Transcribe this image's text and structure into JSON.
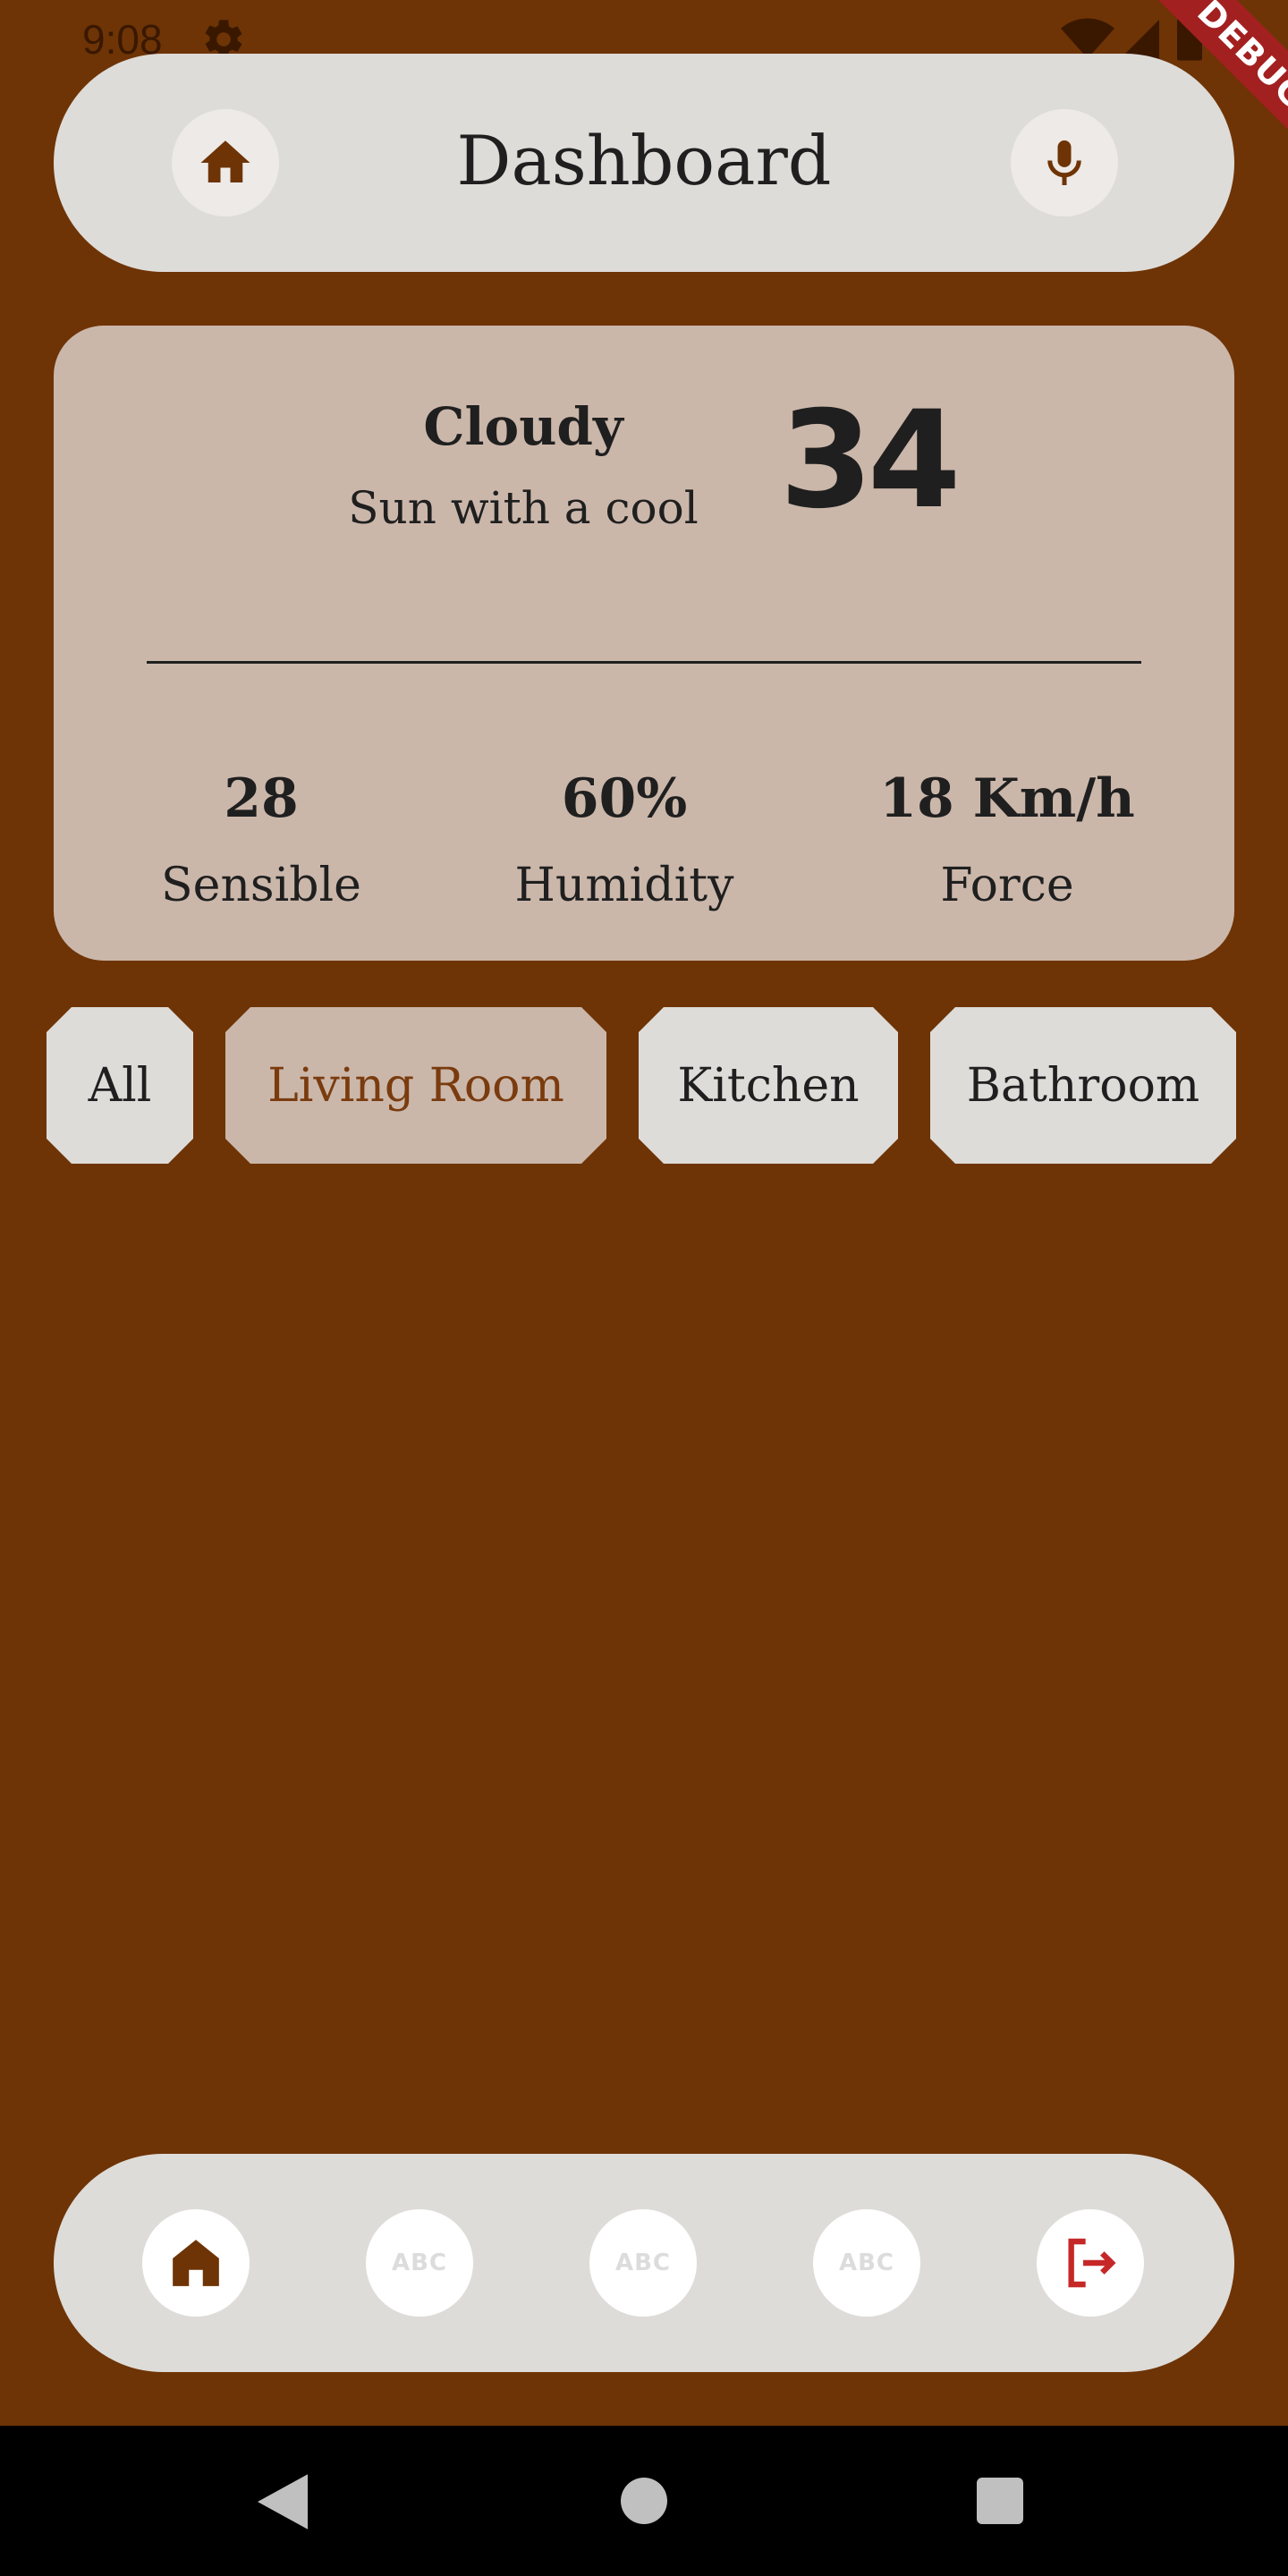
{
  "status_bar": {
    "time": "9:08",
    "icons": [
      "gear-icon",
      "wifi-icon",
      "signal-icon",
      "battery-icon"
    ]
  },
  "debug_banner": "DEBUG",
  "header": {
    "title": "Dashboard",
    "left_icon": "home-icon",
    "right_icon": "microphone-icon"
  },
  "weather": {
    "condition": "Cloudy",
    "description": "Sun with a cool",
    "temperature": "34",
    "stats": [
      {
        "value": "28",
        "label": "Sensible"
      },
      {
        "value": "60%",
        "label": "Humidity"
      },
      {
        "value": "18 Km/h",
        "label": "Force"
      }
    ]
  },
  "rooms": {
    "chips": [
      {
        "label": "All",
        "selected": false
      },
      {
        "label": "Living Room",
        "selected": true
      },
      {
        "label": "Kitchen",
        "selected": false
      },
      {
        "label": "Bathroom",
        "selected": false
      }
    ]
  },
  "bottom_nav": {
    "items": [
      {
        "icon": "home-icon",
        "label": ""
      },
      {
        "icon": "abc-icon",
        "label": "ABC"
      },
      {
        "icon": "abc-icon",
        "label": "ABC"
      },
      {
        "icon": "abc-icon",
        "label": "ABC"
      },
      {
        "icon": "logout-icon",
        "label": ""
      }
    ]
  },
  "colors": {
    "background": "#6e3406",
    "surface": "#dedcd9",
    "card": "#cbb7aa",
    "accent": "#7a3b0e",
    "logout": "#c62828",
    "debug": "#a32020"
  }
}
